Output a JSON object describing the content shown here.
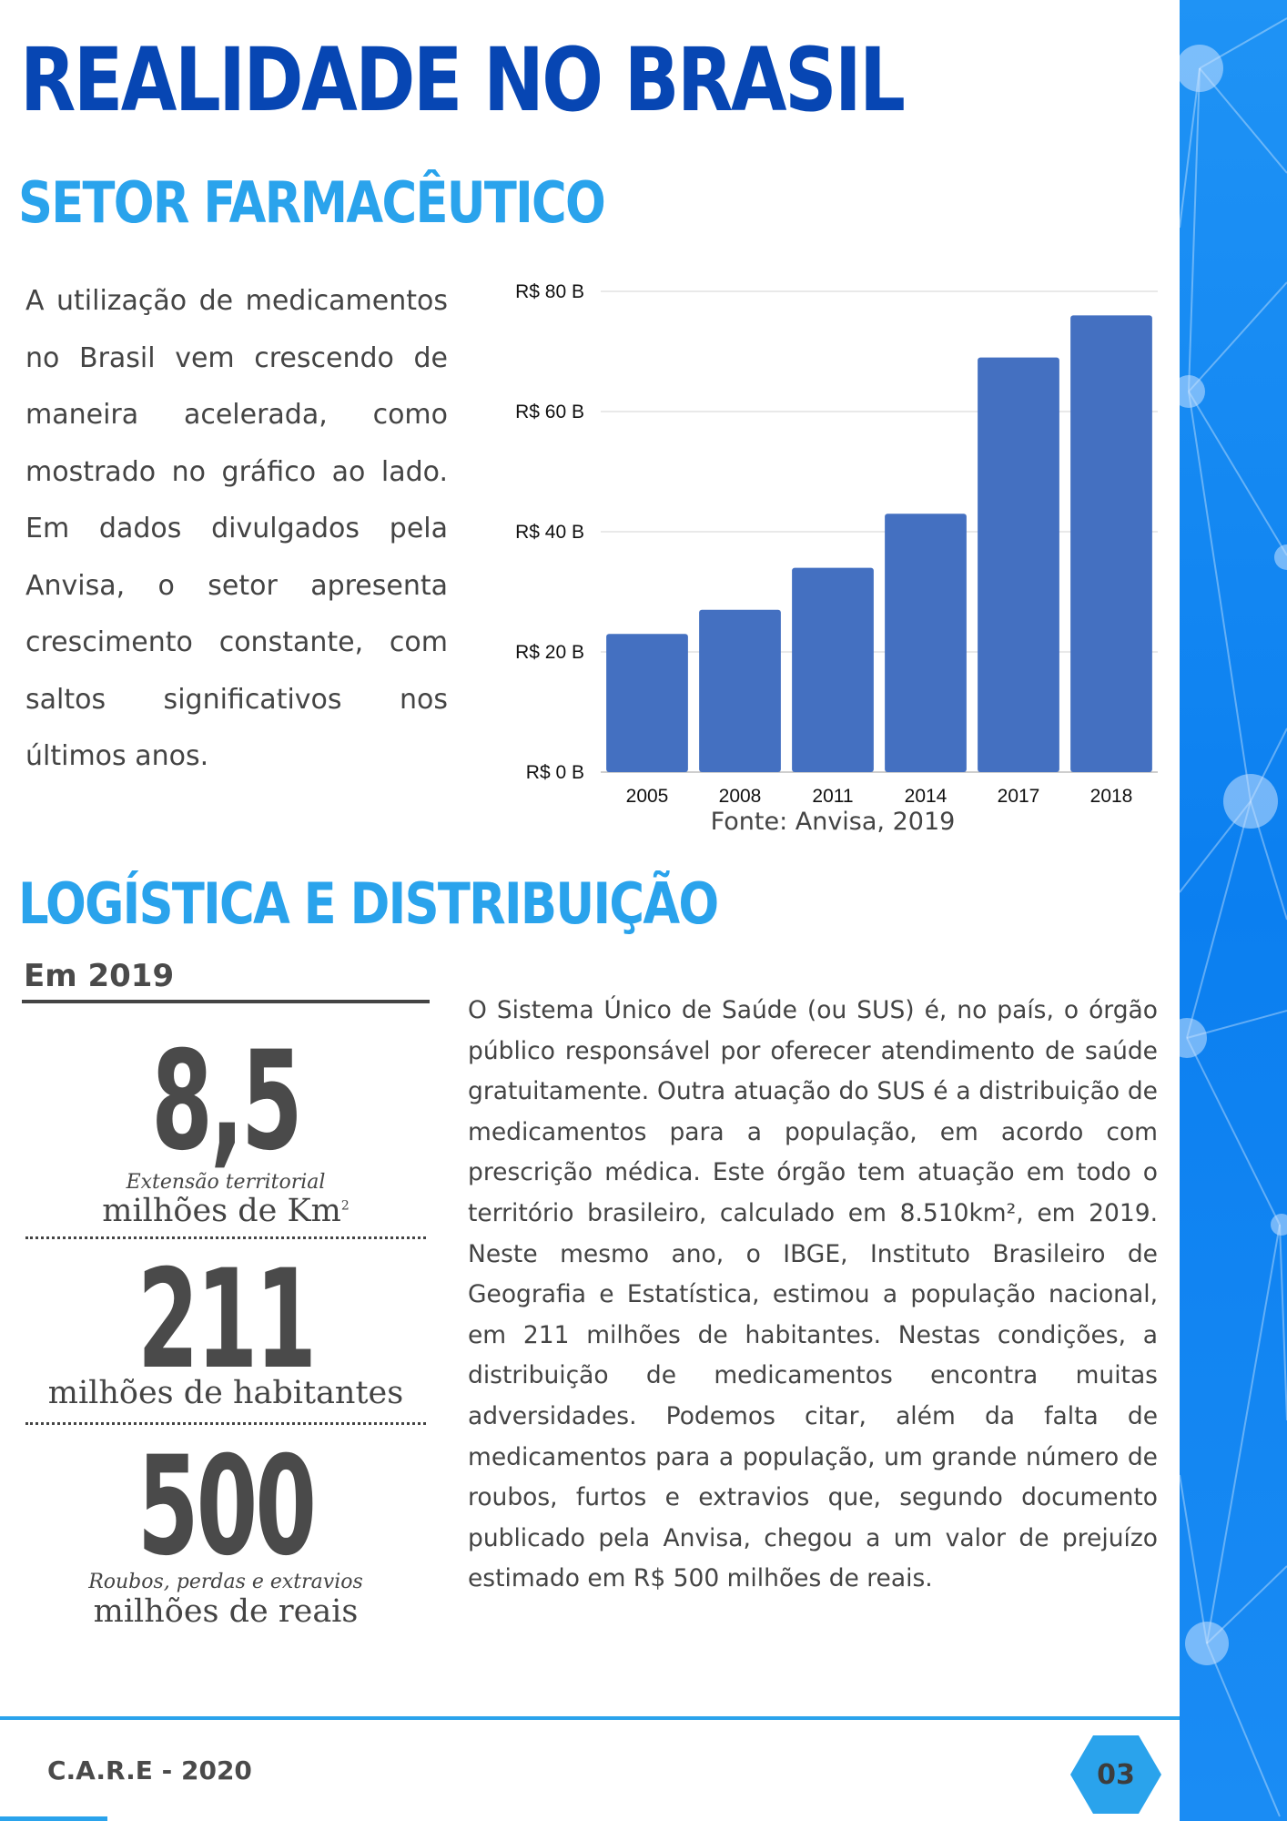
{
  "header": {
    "title": "REALIDADE NO BRASIL"
  },
  "section1": {
    "title": "SETOR FARMACÊUTICO",
    "paragraph": "A utilização de medicamentos no Brasil vem crescendo de maneira acelerada, como mostrado no gráfico ao lado. Em dados divulgados pela Anvisa, o setor apresenta crescimento constante, com saltos significativos nos últimos anos.",
    "source": "Fonte: Anvisa, 2019"
  },
  "chart_data": {
    "type": "bar",
    "categories": [
      "2005",
      "2008",
      "2011",
      "2014",
      "2017",
      "2018"
    ],
    "values": [
      23,
      27,
      34,
      43,
      69,
      76
    ],
    "yticks": [
      "R$ 0 B",
      "R$ 20 B",
      "R$ 40 B",
      "R$ 60 B",
      "R$ 80 B"
    ],
    "ylim": [
      0,
      80
    ],
    "grid": true,
    "bar_color": "#4470c1",
    "xlabel": "",
    "ylabel": "",
    "title": ""
  },
  "section2": {
    "title": "LOGÍSTICA E DISTRIBUIÇÃO",
    "label": "Em 2019",
    "stats": [
      {
        "value": "8,5",
        "caption": "Extensão territorial",
        "unit": "milhões de Km",
        "unit_sup": "2"
      },
      {
        "value": "211",
        "caption": "",
        "unit": "milhões de habitantes",
        "unit_sup": ""
      },
      {
        "value": "500",
        "caption": "Roubos, perdas e extravios",
        "unit": "milhões de reais",
        "unit_sup": ""
      }
    ],
    "paragraph": "O Sistema Único de Saúde (ou SUS) é, no país, o órgão público responsável por oferecer atendimento de saúde gratuitamente. Outra atuação do SUS é a distribuição de medicamentos para a população, em acordo com prescrição médica. Este órgão tem atuação em todo o território brasileiro, calculado em 8.510km², em 2019. Neste mesmo ano, o IBGE, Instituto Brasileiro de Geografia e Estatística, estimou a população nacional, em 211 milhões de habitantes. Nestas condições, a distribuição de medicamentos encontra muitas adversidades. Podemos citar, além da falta de medicamentos para a população, um grande número de roubos, furtos e extravios que, segundo documento publicado pela Anvisa, chegou a um valor de prejuízo estimado em R$ 500 milhões de reais."
  },
  "footer": {
    "left": "C.A.R.E - 2020",
    "page": "03"
  },
  "colors": {
    "title": "#0746b3",
    "section": "#2aa3ec",
    "text": "#444444",
    "side": "#1388f2"
  }
}
